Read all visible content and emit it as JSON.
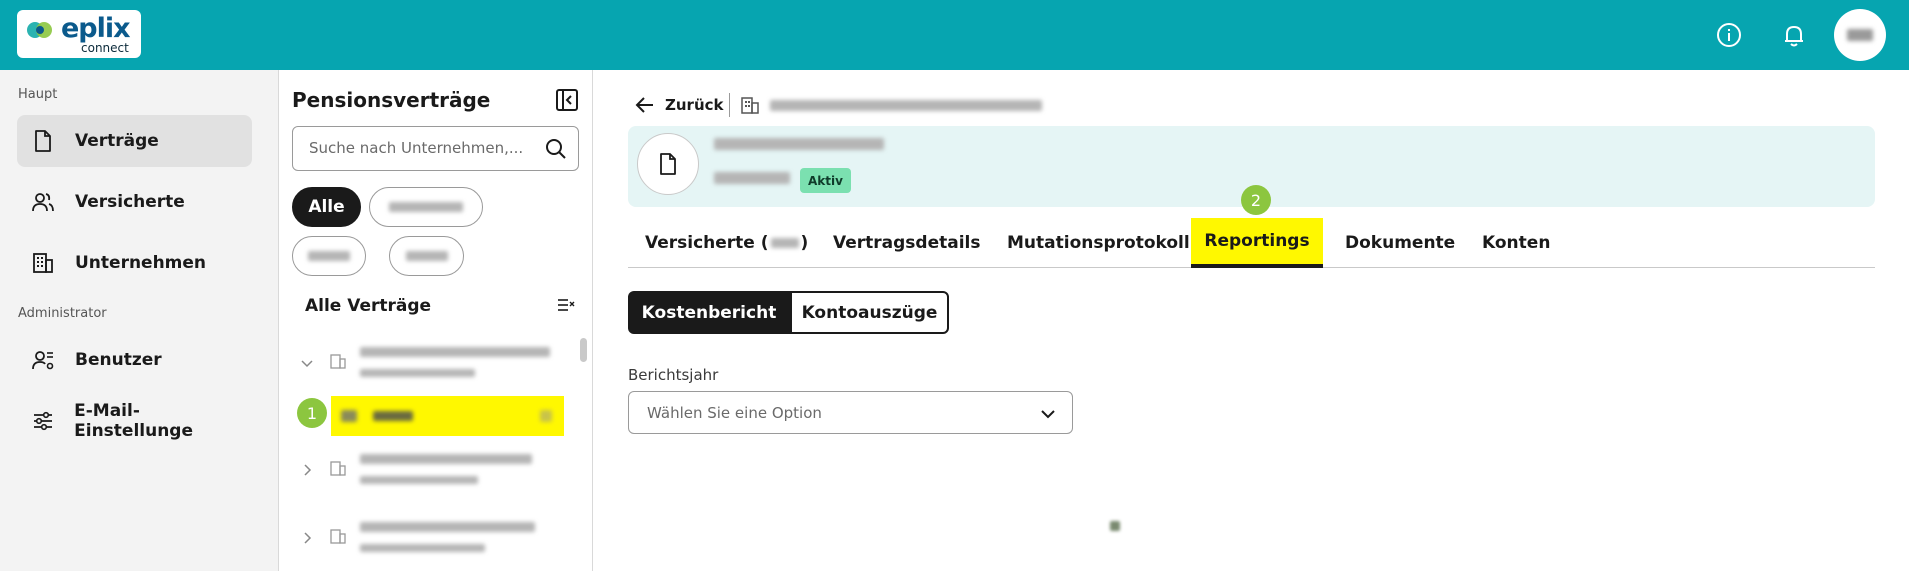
{
  "header": {
    "logo_text": "eplix",
    "logo_sub": "connect",
    "brand_color": "#06a5b0",
    "icons": [
      "info-icon",
      "bell-icon"
    ]
  },
  "leftnav": {
    "section_main": "Haupt",
    "section_admin": "Administrator",
    "items": [
      {
        "label": "Verträge",
        "icon": "document-icon",
        "active": true
      },
      {
        "label": "Versicherte",
        "icon": "users-icon",
        "active": false
      },
      {
        "label": "Unternehmen",
        "icon": "building-icon",
        "active": false
      },
      {
        "label": "Benutzer",
        "icon": "user-admin-icon",
        "active": false
      },
      {
        "label": "E-Mail-Einstellunge",
        "icon": "sliders-icon",
        "active": false
      }
    ]
  },
  "contracts_panel": {
    "title": "Pensionsverträge",
    "search_placeholder": "Suche nach Unternehmen,...",
    "chips": [
      "Alle"
    ],
    "list_title": "Alle Verträge",
    "marker_1": "1"
  },
  "main": {
    "back_label": "Zurück",
    "status_badge": "Aktiv",
    "marker_2": "2",
    "tabs": [
      {
        "label": "Versicherte (",
        "active": false
      },
      {
        "label": "Vertragsdetails",
        "active": false
      },
      {
        "label": "Mutationsprotokoll",
        "active": false
      },
      {
        "label": "Reportings",
        "active": true
      },
      {
        "label": "Dokumente",
        "active": false
      },
      {
        "label": "Konten",
        "active": false
      }
    ],
    "tab_versicherte_suffix": ")",
    "segments": {
      "left": "Kostenbericht",
      "right": "Kontoauszüge"
    },
    "field_label": "Berichtsjahr",
    "select_placeholder": "Wählen Sie eine Option"
  }
}
